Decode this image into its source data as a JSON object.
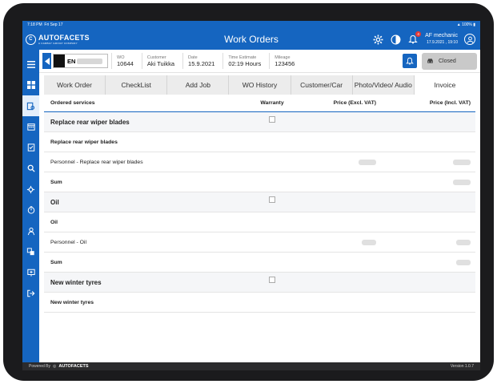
{
  "status_bar": {
    "time": "7:18 PM",
    "date": "Fri Sep 17",
    "battery": "100%"
  },
  "app": {
    "logo_text": "AUTOFACETS",
    "logo_sub": "A CARBAY GROUP COMPANY",
    "title": "Work Orders"
  },
  "user": {
    "name": "AF mechanic",
    "datetime": "17.9.2021 , 19:10"
  },
  "notifications": {
    "count": "4"
  },
  "work_order": {
    "plate": "EN",
    "fields": [
      {
        "label": "WO",
        "value": "10644"
      },
      {
        "label": "Customer",
        "value": "Aki Tuikka"
      },
      {
        "label": "Date",
        "value": "15.9.2021"
      },
      {
        "label": "Time Estimate",
        "value": "02:19 Hours"
      },
      {
        "label": "Mileage",
        "value": "123456"
      }
    ],
    "status_label": "Closed"
  },
  "tabs": [
    {
      "label": "Work Order",
      "active": false
    },
    {
      "label": "CheckList",
      "active": false
    },
    {
      "label": "Add Job",
      "active": false
    },
    {
      "label": "WO History",
      "active": false
    },
    {
      "label": "Customer/Car",
      "active": false
    },
    {
      "label": "Photo/Video/ Audio",
      "active": false
    },
    {
      "label": "Invoice",
      "active": true
    }
  ],
  "table": {
    "headers": [
      "Ordered services",
      "Warranty",
      "Price (Excl. VAT)",
      "Price (Incl. VAT)"
    ],
    "rows": [
      {
        "kind": "group",
        "label": "Replace rear wiper blades",
        "checkbox": true
      },
      {
        "kind": "service",
        "label": "Replace rear wiper blades"
      },
      {
        "kind": "line",
        "label": "Personnel - Replace rear wiper blades",
        "blurred": true
      },
      {
        "kind": "sum",
        "label": "Sum",
        "blurred_incl": true
      },
      {
        "kind": "group",
        "label": "Oil",
        "checkbox": true
      },
      {
        "kind": "service",
        "label": "Oil"
      },
      {
        "kind": "line",
        "label": "Personnel - Oil",
        "blurred": true
      },
      {
        "kind": "sum",
        "label": "Sum",
        "blurred_incl": true
      },
      {
        "kind": "group",
        "label": "New winter tyres",
        "checkbox": true
      },
      {
        "kind": "service",
        "label": "New winter tyres"
      }
    ]
  },
  "footer": {
    "powered_by": "Powered By",
    "brand": "AUTOFACETS",
    "version": "Version 1.0.7"
  },
  "colors": {
    "primary": "#1565c0",
    "footer": "#2b2b2d",
    "device": "#1b1b1d"
  }
}
